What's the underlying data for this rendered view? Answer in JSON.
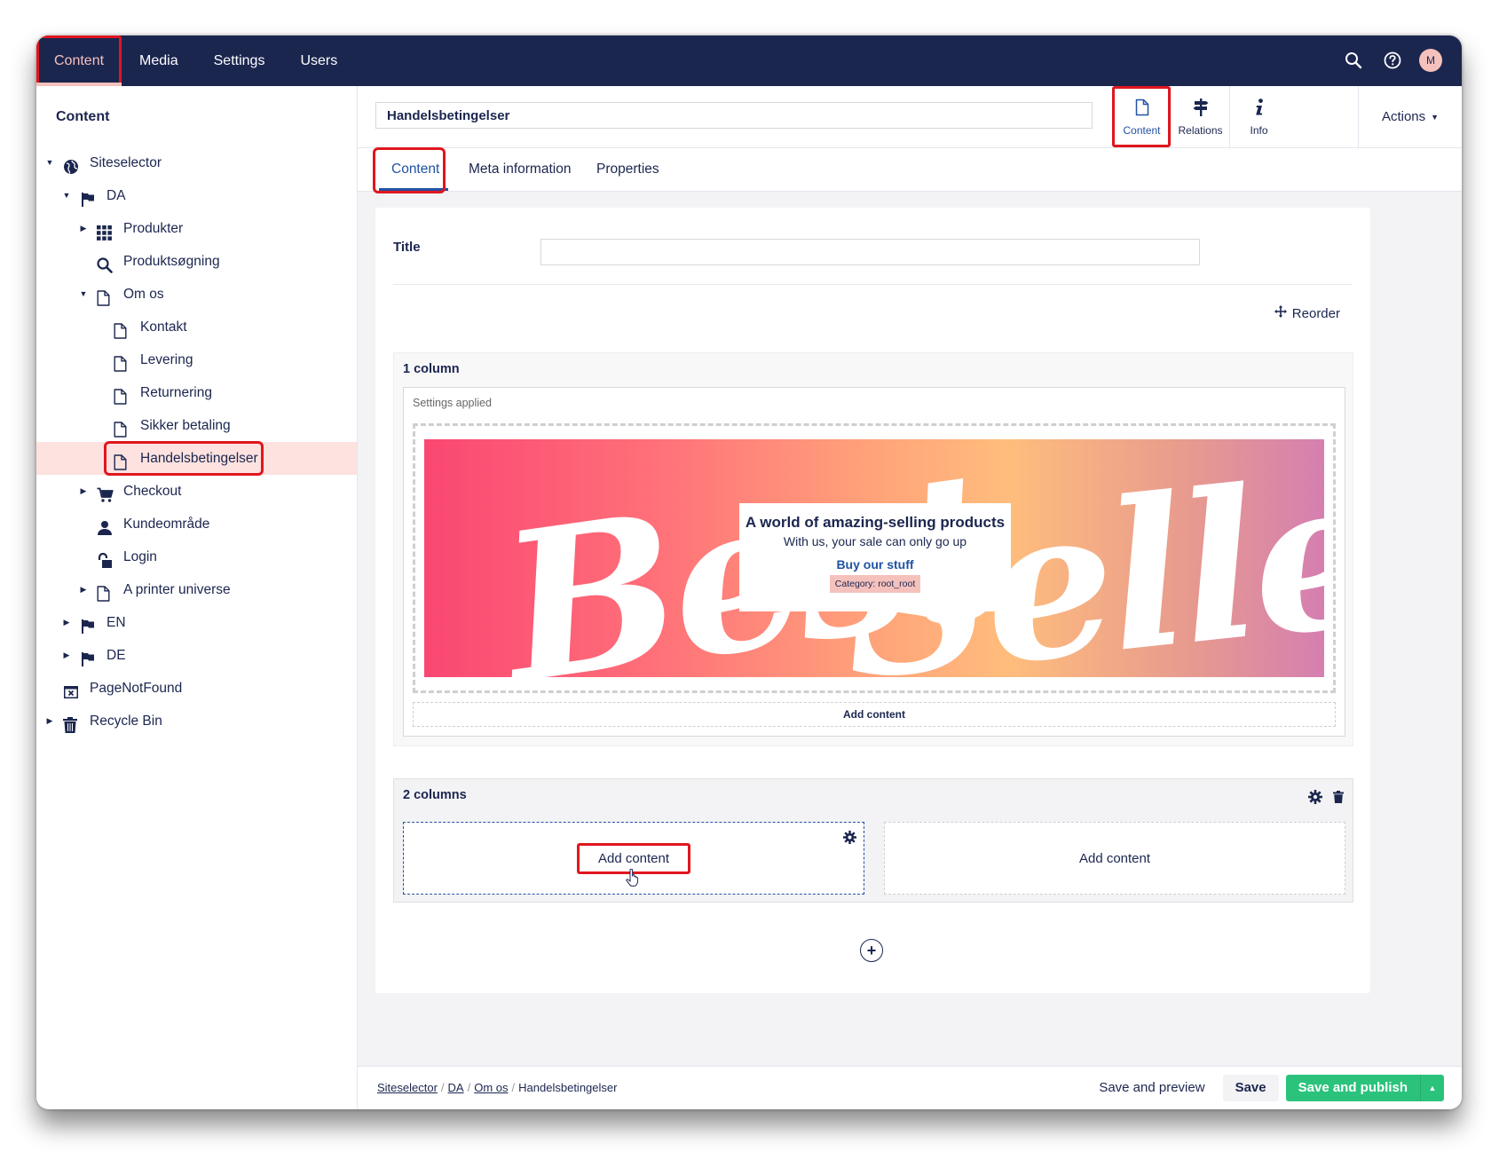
{
  "topnav": {
    "items": [
      "Content",
      "Media",
      "Settings",
      "Users"
    ],
    "active": "Content",
    "avatar_initial": "M"
  },
  "sidebar": {
    "title": "Content",
    "tree": [
      {
        "label": "Siteselector",
        "icon": "globe-icon",
        "caret": "down",
        "level": 0
      },
      {
        "label": "DA",
        "icon": "flag-icon",
        "caret": "down",
        "level": 1
      },
      {
        "label": "Produkter",
        "icon": "grid-icon",
        "caret": "right",
        "level": 2
      },
      {
        "label": "Produktsøgning",
        "icon": "search-icon",
        "caret": "",
        "level": 2
      },
      {
        "label": "Om os",
        "icon": "document-icon",
        "caret": "down",
        "level": 2
      },
      {
        "label": "Kontakt",
        "icon": "document-icon",
        "caret": "",
        "level": 3
      },
      {
        "label": "Levering",
        "icon": "document-icon",
        "caret": "",
        "level": 3
      },
      {
        "label": "Returnering",
        "icon": "document-icon",
        "caret": "",
        "level": 3
      },
      {
        "label": "Sikker betaling",
        "icon": "document-icon",
        "caret": "",
        "level": 3
      },
      {
        "label": "Handelsbetingelser",
        "icon": "document-icon",
        "caret": "",
        "level": 3,
        "selected": true
      },
      {
        "label": "Checkout",
        "icon": "cart-icon",
        "caret": "right",
        "level": 2
      },
      {
        "label": "Kundeområde",
        "icon": "user-icon",
        "caret": "",
        "level": 2
      },
      {
        "label": "Login",
        "icon": "unlock-icon",
        "caret": "",
        "level": 2
      },
      {
        "label": "A printer universe",
        "icon": "document-icon",
        "caret": "right",
        "level": 2
      },
      {
        "label": "EN",
        "icon": "flag-icon",
        "caret": "right",
        "level": 1
      },
      {
        "label": "DE",
        "icon": "flag-icon",
        "caret": "right",
        "level": 1
      },
      {
        "label": "PageNotFound",
        "icon": "error-page-icon",
        "caret": "",
        "level": 0
      },
      {
        "label": "Recycle Bin",
        "icon": "trash-icon",
        "caret": "right",
        "level": 0
      }
    ]
  },
  "editor": {
    "node_name": "Handelsbetingelser",
    "apps": [
      {
        "label": "Content",
        "icon": "document-icon",
        "active": true
      },
      {
        "label": "Relations",
        "icon": "signpost-icon"
      },
      {
        "label": "Info",
        "icon": "info-icon"
      }
    ],
    "actions_label": "Actions",
    "tabs": [
      "Content",
      "Meta information",
      "Properties"
    ],
    "active_tab": "Content",
    "title_label": "Title",
    "title_value": "",
    "reorder_label": "Reorder",
    "block1": {
      "title": "1 column",
      "settings_applied": "Settings applied",
      "banner": {
        "script_text_left": "Best",
        "script_text_right": "Sellers",
        "headline": "A world of amazing-selling products",
        "subline": "With us, your sale can only go up",
        "link": "Buy our stuff",
        "category": "Category: root_root"
      },
      "add_content": "Add content"
    },
    "block2": {
      "title": "2 columns",
      "col1_add": "Add content",
      "col2_add": "Add content"
    }
  },
  "footer": {
    "breadcrumbs": [
      "Siteselector",
      "DA",
      "Om os",
      "Handelsbetingelser"
    ],
    "save_preview": "Save and preview",
    "save": "Save",
    "save_publish": "Save and publish"
  },
  "colors": {
    "topbar": "#1b264f",
    "accent_active": "#f5c1bc",
    "primary_blue": "#2152a3",
    "publish_green": "#2bc37c",
    "highlight_red": "#e0161e",
    "selected_row": "#fde2e0"
  }
}
